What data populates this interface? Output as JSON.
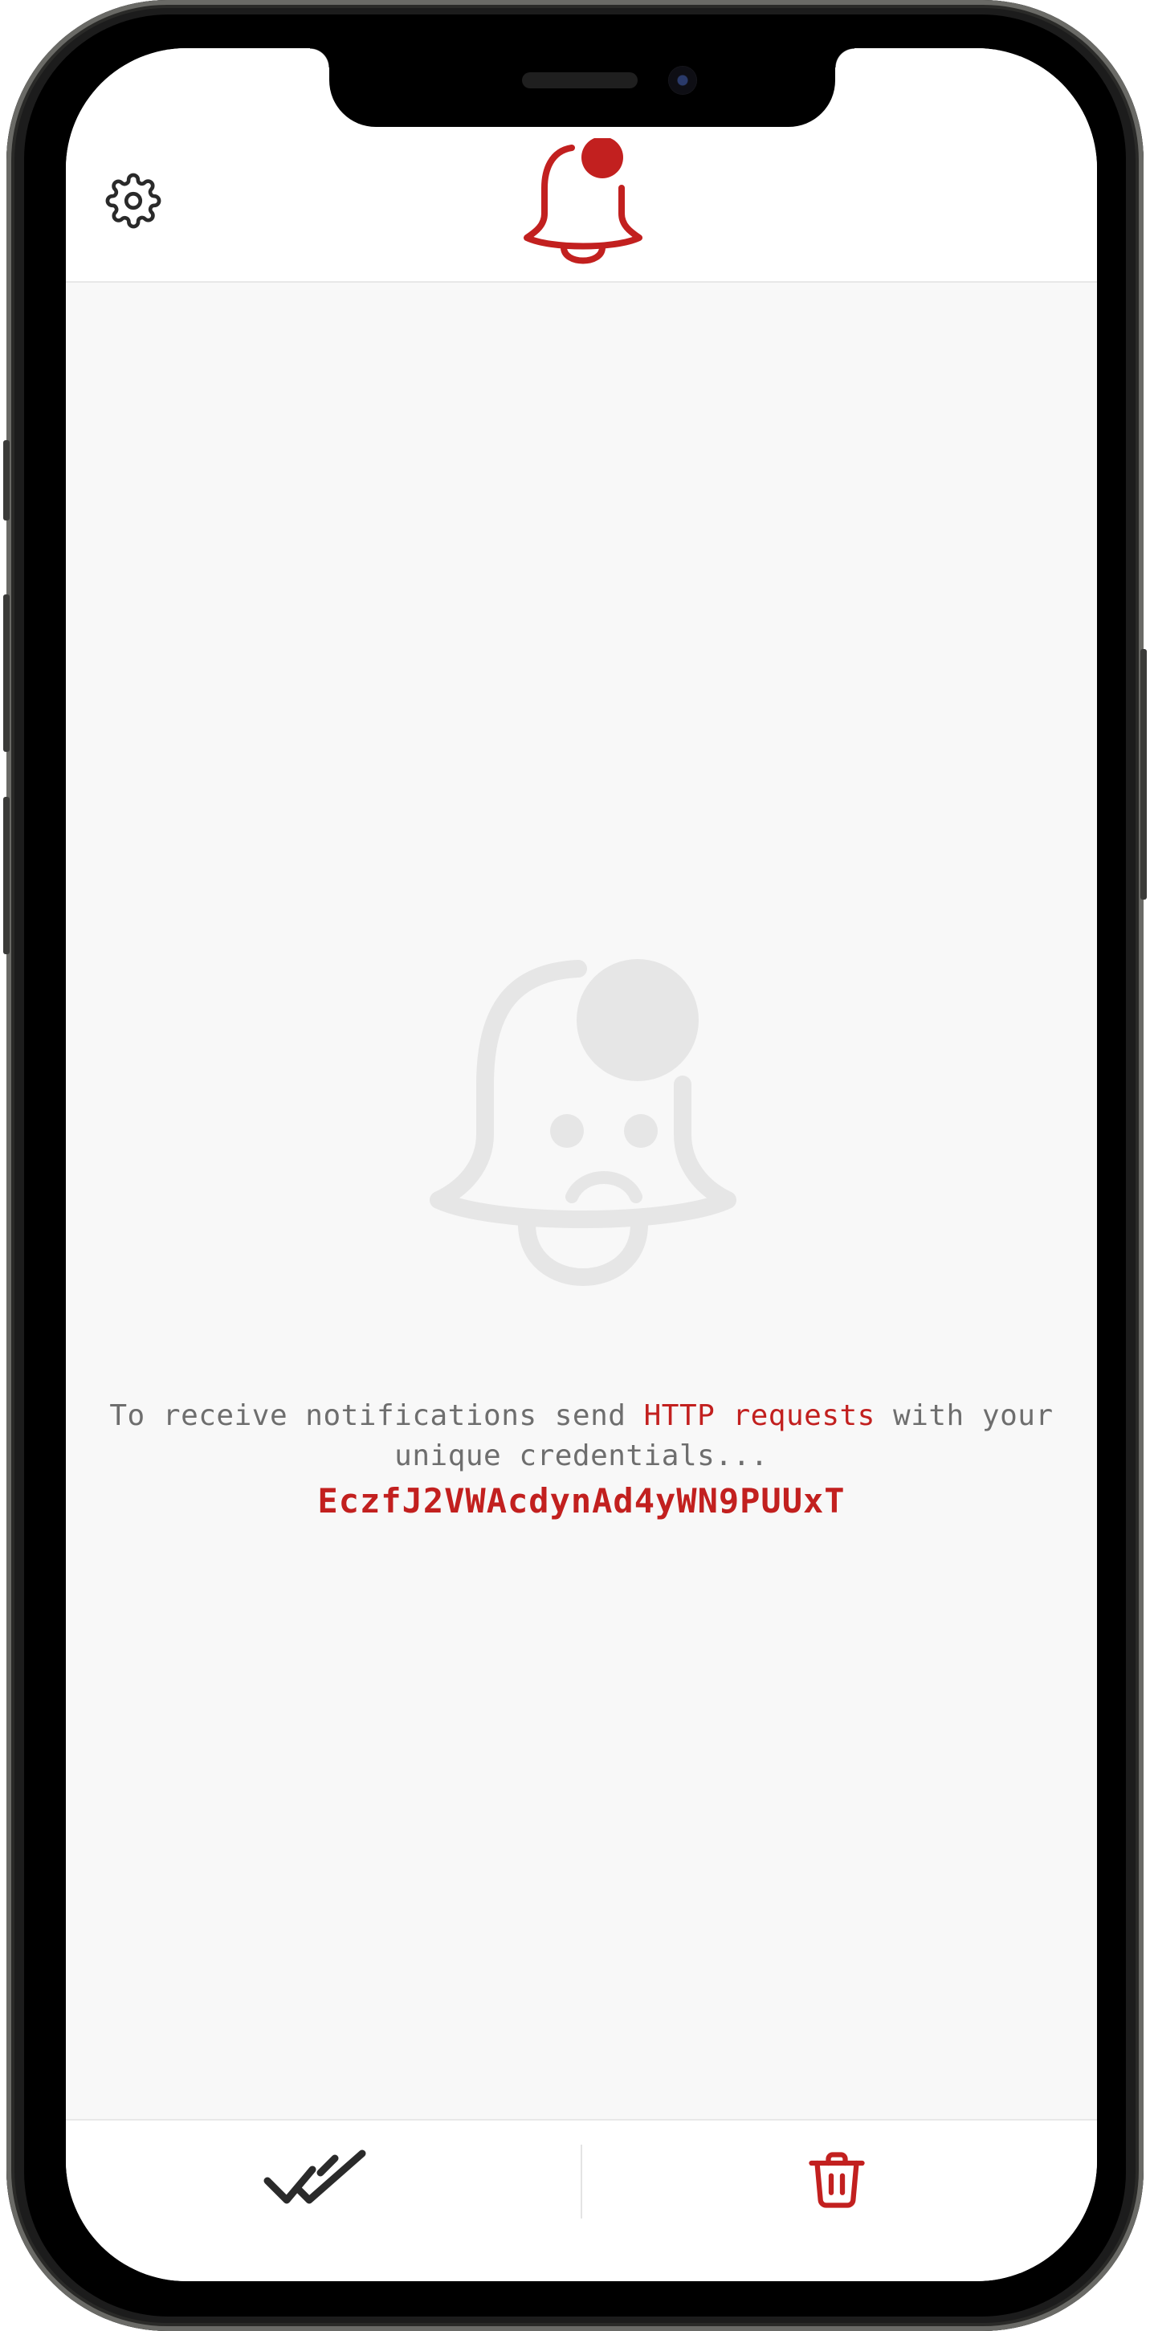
{
  "colors": {
    "accent": "#c2201f",
    "muted_text": "#6e6e6e",
    "background": "#f8f8f8",
    "illustration": "#e6e6e6",
    "icon_dark": "#2a2a2a"
  },
  "header": {
    "settings_icon": "gear-icon",
    "logo_icon": "bell-with-dot-icon"
  },
  "empty_state": {
    "illustration_icon": "sad-bell-icon",
    "message_prefix": "To receive notifications send ",
    "message_highlight": "HTTP requests",
    "message_suffix": " with your unique credentials...",
    "credential": "EczfJ2VWAcdynAd4yWN9PUUxT"
  },
  "bottom_bar": {
    "mark_all_read_icon": "double-check-icon",
    "delete_icon": "trash-icon"
  }
}
